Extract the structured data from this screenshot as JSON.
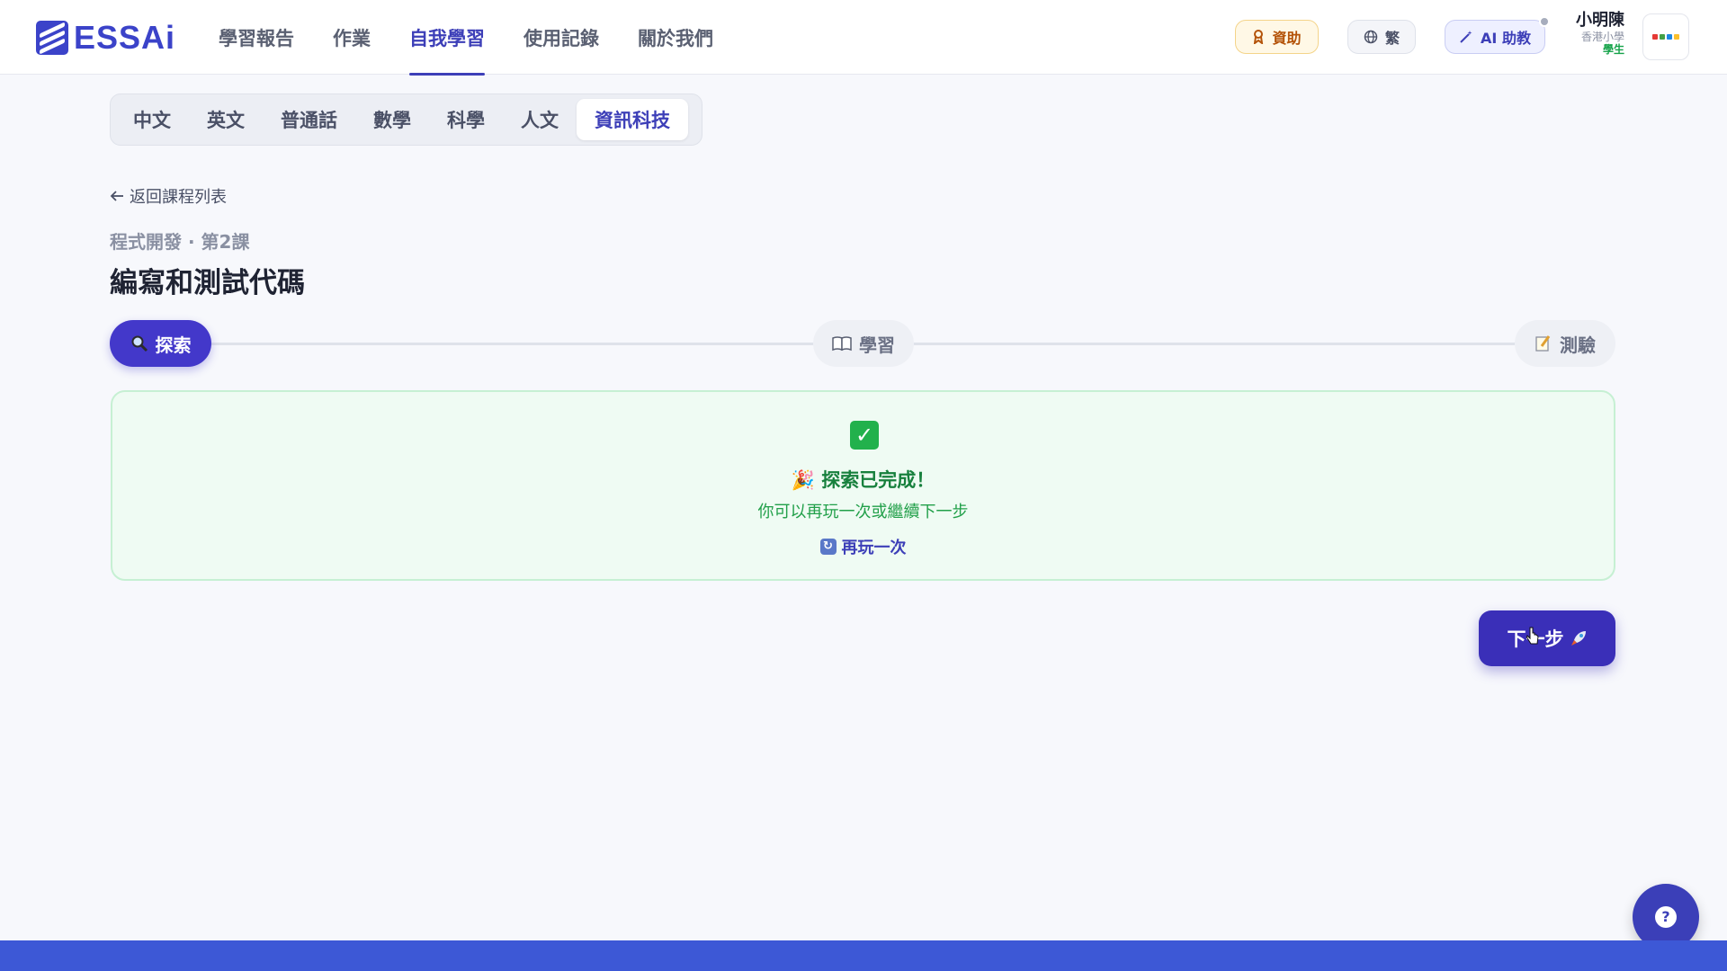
{
  "app": {
    "logo_text": "ESSAi",
    "brand_color": "#3b43c9"
  },
  "nav": {
    "items": [
      {
        "label": "學習報告",
        "active": false
      },
      {
        "label": "作業",
        "active": false
      },
      {
        "label": "自我學習",
        "active": true
      },
      {
        "label": "使用記錄",
        "active": false
      },
      {
        "label": "關於我們",
        "active": false
      }
    ]
  },
  "header": {
    "sponsor_label": "資助",
    "sponsor_icon": "ribbon-icon",
    "lang_label": "繁",
    "lang_icon": "globe-icon",
    "ai_label": "AI 助教",
    "ai_icon": "magic-wand-icon",
    "user_name": "小明陳",
    "user_school": "香港小學",
    "user_role": "學生"
  },
  "subjects": {
    "tabs": [
      {
        "label": "中文"
      },
      {
        "label": "英文"
      },
      {
        "label": "普通話"
      },
      {
        "label": "數學"
      },
      {
        "label": "科學"
      },
      {
        "label": "人文"
      },
      {
        "label": "資訊科技"
      }
    ],
    "active": "資訊科技"
  },
  "lesson": {
    "back_label": "返回課程列表",
    "breadcrumb": "程式開發 · 第2課",
    "title": "編寫和測試代碼"
  },
  "stepper": {
    "explore": {
      "label": "探索",
      "icon": "magnifier-icon"
    },
    "learn": {
      "label": "學習",
      "icon": "book-icon"
    },
    "quiz": {
      "label": "測驗",
      "icon": "memo-icon"
    }
  },
  "completion": {
    "title": "探索已完成！",
    "title_icon": "party-popper-icon",
    "description": "你可以再玩一次或繼續下一步",
    "replay_label": "再玩一次",
    "replay_icon": "repeat-icon"
  },
  "next_button": {
    "label": "下一步",
    "icon": "rocket-icon"
  },
  "help_button": {
    "label": "?"
  },
  "colors": {
    "primary": "#4338ca",
    "success_bg": "#effbf3",
    "success_text": "#17803d",
    "footer": "#3d58d6"
  }
}
